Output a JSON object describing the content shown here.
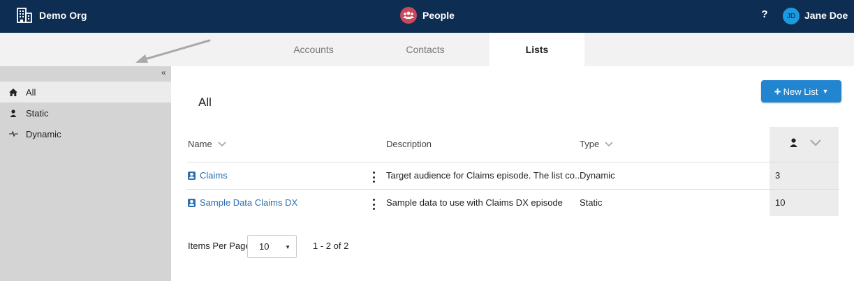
{
  "header": {
    "org_name": "Demo Org",
    "app_name": "People",
    "help_label": "?",
    "user_initials": "JD",
    "user_name": "Jane Doe",
    "colors": {
      "bar": "#0e2d52",
      "app_icon": "#c9495b",
      "avatar": "#1a9be0"
    }
  },
  "tabs": [
    {
      "label": "Accounts",
      "active": false
    },
    {
      "label": "Contacts",
      "active": false
    },
    {
      "label": "Lists",
      "active": true
    }
  ],
  "sidebar": {
    "collapse_label": "«",
    "items": [
      {
        "label": "All",
        "icon": "home-icon",
        "active": true
      },
      {
        "label": "Static",
        "icon": "person-icon",
        "active": false
      },
      {
        "label": "Dynamic",
        "icon": "pulse-icon",
        "active": false
      }
    ]
  },
  "main": {
    "title": "All",
    "new_button": {
      "label": "New List",
      "accent": "#2185d0"
    },
    "table": {
      "columns": {
        "name": "Name",
        "description": "Description",
        "type": "Type"
      },
      "rows": [
        {
          "name": "Claims",
          "description": "Target audience for Claims episode. The list co...",
          "type": "Dynamic",
          "count": "3"
        },
        {
          "name": "Sample Data Claims DX",
          "description": "Sample data to use with Claims DX episode",
          "type": "Static",
          "count": "10"
        }
      ]
    },
    "pagination": {
      "items_per_page_label": "Items Per Page",
      "items_per_page": "10",
      "range": "1 - 2 of 2"
    }
  }
}
